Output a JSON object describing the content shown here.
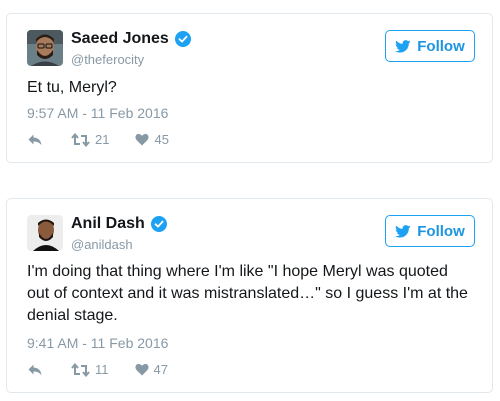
{
  "colors": {
    "accent": "#1da1f2",
    "text_dark": "#14171a",
    "text_muted": "#8899a6",
    "border": "#e1e8ed"
  },
  "tweets": [
    {
      "author": {
        "name": "Saeed Jones",
        "handle": "@theferocity",
        "verified": true,
        "avatar_icon": "user-avatar"
      },
      "follow_label": "Follow",
      "text": "Et tu, Meryl?",
      "timestamp": "9:57 AM - 11 Feb 2016",
      "retweets": "21",
      "likes": "45"
    },
    {
      "author": {
        "name": "Anil Dash",
        "handle": "@anildash",
        "verified": true,
        "avatar_icon": "user-avatar"
      },
      "follow_label": "Follow",
      "text": "I'm doing that thing where I'm like \"I hope Meryl was quoted out of context and it was mistranslated…\" so I guess I'm at the denial stage.",
      "timestamp": "9:41 AM - 11 Feb 2016",
      "retweets": "11",
      "likes": "47"
    }
  ]
}
